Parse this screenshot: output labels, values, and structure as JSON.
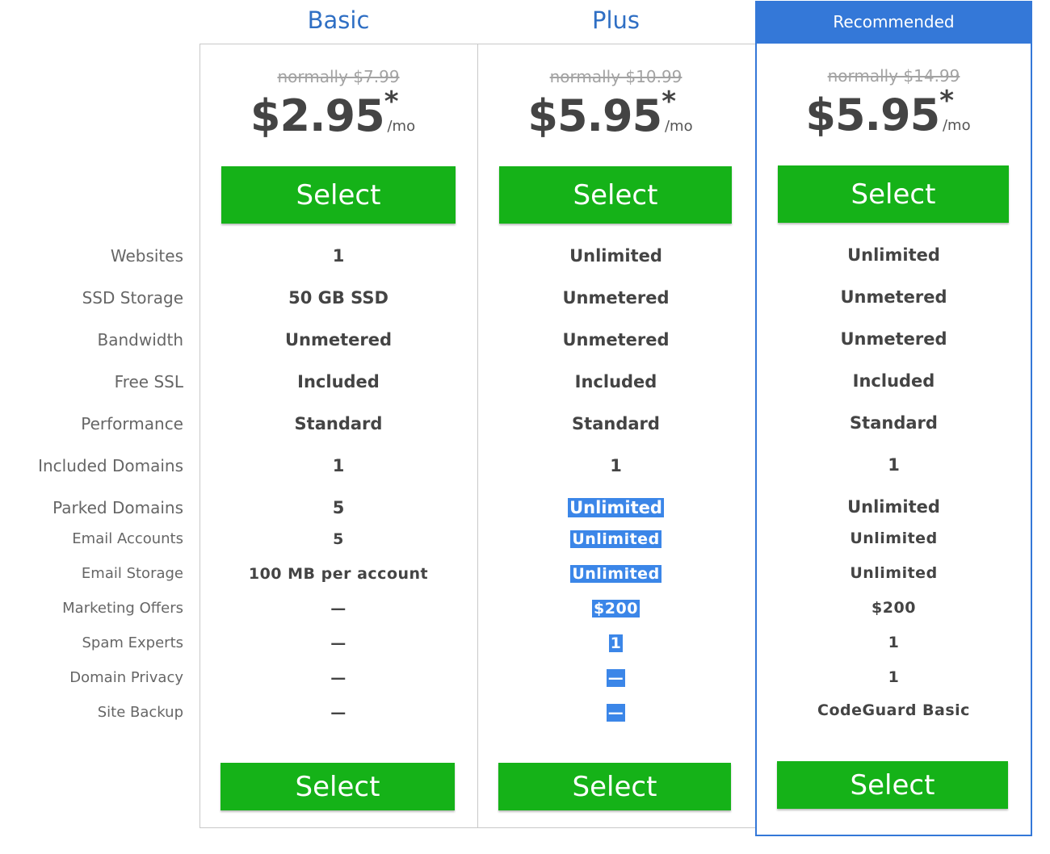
{
  "plans": [
    {
      "name": "Basic",
      "normal_price": "normally $7.99",
      "price": "$2.95",
      "star": "*",
      "per": "/mo",
      "select_label": "Select",
      "values": [
        "1",
        "50 GB SSD",
        "Unmetered",
        "Included",
        "Standard",
        "1",
        "5",
        "5",
        "100 MB per account",
        "—",
        "—",
        "—",
        "—"
      ]
    },
    {
      "name": "Plus",
      "normal_price": "normally $10.99",
      "price": "$5.95",
      "star": "*",
      "per": "/mo",
      "select_label": "Select",
      "values": [
        "Unlimited",
        "Unmetered",
        "Unmetered",
        "Included",
        "Standard",
        "1",
        "Unlimited",
        "Unlimited",
        "Unlimited",
        "$200",
        "1",
        "—",
        "—"
      ]
    },
    {
      "name": "Recommended",
      "normal_price": "normally $14.99",
      "price": "$5.95",
      "star": "*",
      "per": "/mo",
      "select_label": "Select",
      "values": [
        "Unlimited",
        "Unmetered",
        "Unmetered",
        "Included",
        "Standard",
        "1",
        "Unlimited",
        "Unlimited",
        "Unlimited",
        "$200",
        "1",
        "1",
        "CodeGuard Basic"
      ]
    }
  ],
  "features": [
    "Websites",
    "SSD Storage",
    "Bandwidth",
    "Free SSL",
    "Performance",
    "Included Domains",
    "Parked Domains",
    "Email Accounts",
    "Email Storage",
    "Marketing Offers",
    "Spam Experts",
    "Domain Privacy",
    "Site Backup"
  ],
  "colors": {
    "accent_blue": "#3478d8",
    "select_green": "#15b218",
    "highlight": "#3b86e8"
  }
}
